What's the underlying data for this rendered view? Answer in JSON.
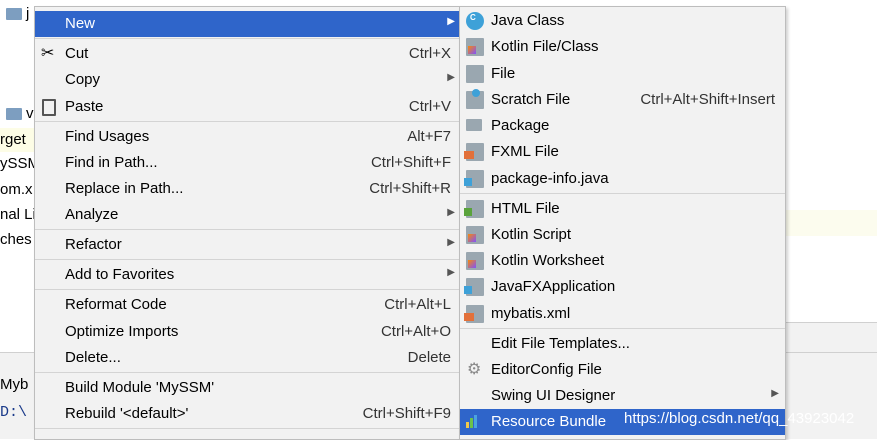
{
  "background": {
    "fragments": [
      "j",
      "v",
      "rget",
      "ySSM",
      "om.x",
      "nal Li",
      "ches",
      "Myb",
      "D:\\"
    ]
  },
  "context_menu": {
    "items": [
      {
        "label": "New",
        "shortcut": "",
        "submenu": true
      },
      {
        "label": "Cut",
        "shortcut": "Ctrl+X"
      },
      {
        "label": "Copy",
        "shortcut": "",
        "submenu": true
      },
      {
        "label": "Paste",
        "shortcut": "Ctrl+V"
      },
      {
        "label": "Find Usages",
        "shortcut": "Alt+F7"
      },
      {
        "label": "Find in Path...",
        "shortcut": "Ctrl+Shift+F"
      },
      {
        "label": "Replace in Path...",
        "shortcut": "Ctrl+Shift+R"
      },
      {
        "label": "Analyze",
        "shortcut": "",
        "submenu": true
      },
      {
        "label": "Refactor",
        "shortcut": "",
        "submenu": true
      },
      {
        "label": "Add to Favorites",
        "shortcut": "",
        "submenu": true
      },
      {
        "label": "Reformat Code",
        "shortcut": "Ctrl+Alt+L"
      },
      {
        "label": "Optimize Imports",
        "shortcut": "Ctrl+Alt+O"
      },
      {
        "label": "Delete...",
        "shortcut": "Delete"
      },
      {
        "label": "Build Module 'MySSM'",
        "shortcut": ""
      },
      {
        "label": "Rebuild '<default>'",
        "shortcut": "Ctrl+Shift+F9"
      }
    ]
  },
  "new_submenu": {
    "items": [
      {
        "label": "Java Class",
        "icon": "java-class-icon"
      },
      {
        "label": "Kotlin File/Class",
        "icon": "kotlin-file-icon"
      },
      {
        "label": "File",
        "icon": "file-icon"
      },
      {
        "label": "Scratch File",
        "shortcut": "Ctrl+Alt+Shift+Insert",
        "icon": "scratch-file-icon"
      },
      {
        "label": "Package",
        "icon": "package-folder-icon"
      },
      {
        "label": "FXML File",
        "icon": "fxml-file-icon"
      },
      {
        "label": "package-info.java",
        "icon": "java-file-icon"
      },
      {
        "label": "HTML File",
        "icon": "html-file-icon"
      },
      {
        "label": "Kotlin Script",
        "icon": "kotlin-script-icon"
      },
      {
        "label": "Kotlin Worksheet",
        "icon": "kotlin-worksheet-icon"
      },
      {
        "label": "JavaFXApplication",
        "icon": "javafx-file-icon"
      },
      {
        "label": "mybatis.xml",
        "icon": "xml-file-icon"
      },
      {
        "label": "Edit File Templates..."
      },
      {
        "label": "EditorConfig File",
        "icon": "gear-icon"
      },
      {
        "label": "Swing UI Designer",
        "submenu": true
      },
      {
        "label": "Resource Bundle",
        "icon": "resource-bundle-icon"
      }
    ]
  },
  "watermark": "https://blog.csdn.net/qq_43923042",
  "colors": {
    "selection": "#2f65ca",
    "menu_bg": "#f2f2f2"
  }
}
